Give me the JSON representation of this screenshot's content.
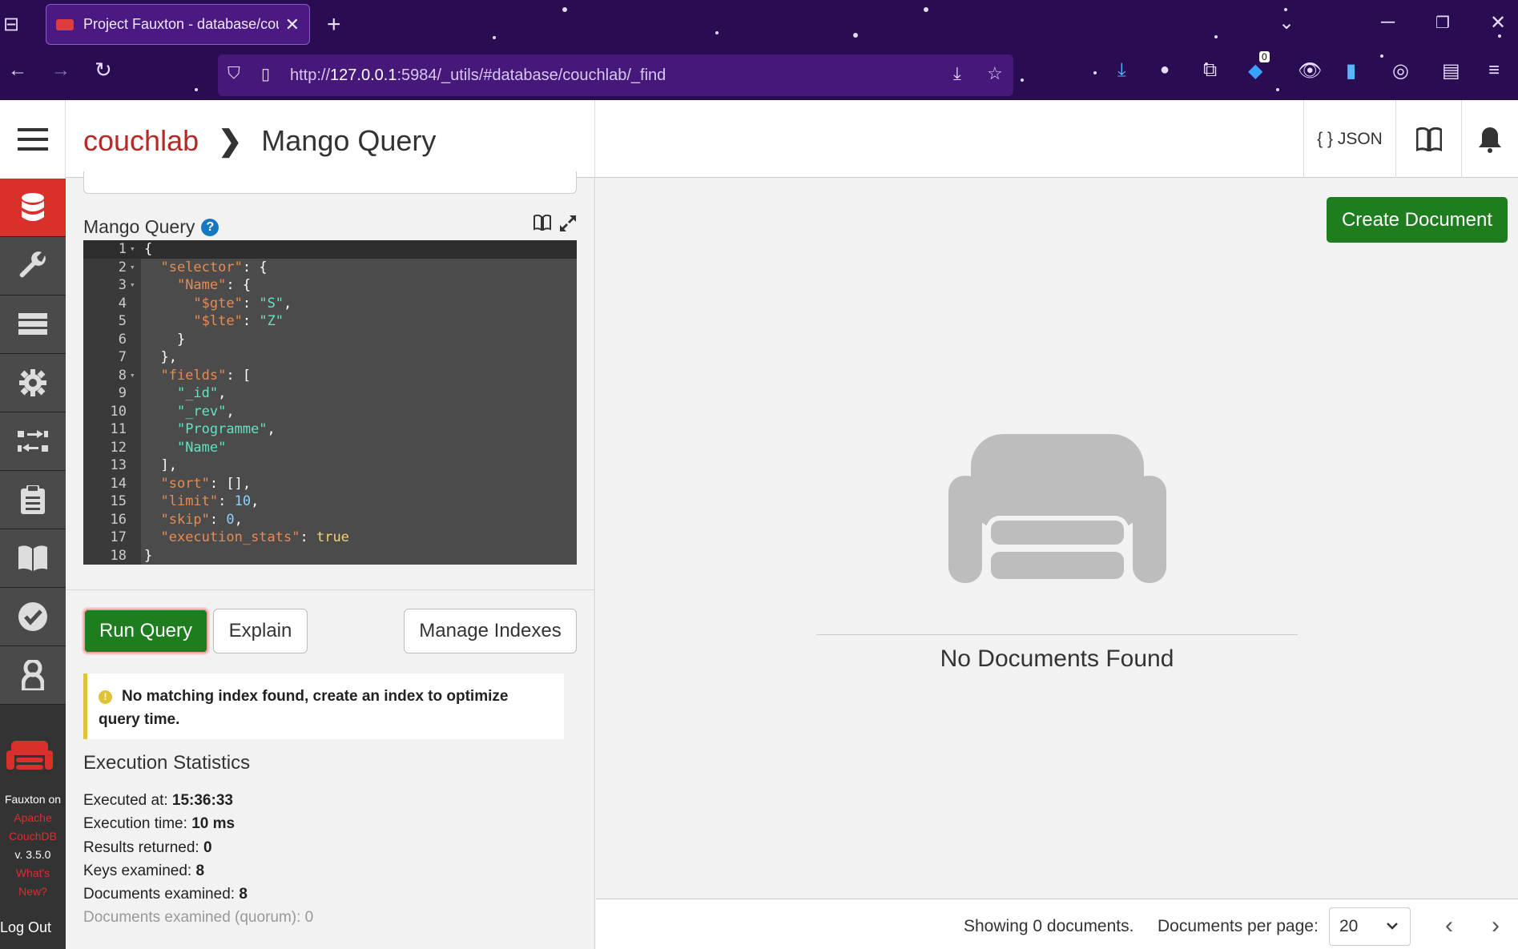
{
  "browser": {
    "tab_title": "Project Fauxton - database/couc",
    "url_prefix": "http://",
    "url_host": "127.0.0.1",
    "url_rest": ":5984/_utils/#database/couchlab/_find",
    "extension_badge": "0"
  },
  "sidebar": {
    "product": "Fauxton on",
    "apache": "Apache",
    "couchdb": "CouchDB",
    "version": "v. 3.5.0",
    "whats_new": "What's New?",
    "logout": "Log Out"
  },
  "header": {
    "database": "couchlab",
    "page": "Mango Query",
    "json_label": "{ } JSON"
  },
  "query": {
    "label": "Mango Query",
    "help": "?",
    "lines": [
      "{",
      "  \"selector\": {",
      "    \"Name\": {",
      "      \"$gte\": \"S\",",
      "      \"$lte\": \"Z\"",
      "    }",
      "  },",
      "  \"fields\": [",
      "    \"_id\",",
      "    \"_rev\",",
      "    \"Programme\",",
      "    \"Name\"",
      "  ],",
      "  \"sort\": [],",
      "  \"limit\": 10,",
      "  \"skip\": 0,",
      "  \"execution_stats\": true",
      "}"
    ],
    "run_button": "Run Query",
    "explain_button": "Explain",
    "indexes_button": "Manage Indexes",
    "warning": "No matching index found, create an index to optimize query time."
  },
  "stats": {
    "title": "Execution Statistics",
    "executed_at_label": "Executed at:",
    "executed_at": "15:36:33",
    "exec_time_label": "Execution time:",
    "exec_time": "10 ms",
    "results_label": "Results returned:",
    "results": "0",
    "keys_label": "Keys examined:",
    "keys": "8",
    "docs_label": "Documents examined:",
    "docs": "8",
    "quorum_label": "Documents examined (quorum):",
    "quorum": "0"
  },
  "results": {
    "create_button": "Create Document",
    "empty_message": "No Documents Found",
    "showing": "Showing 0 documents.",
    "per_page_label": "Documents per page:",
    "per_page_value": "20",
    "prev": "‹",
    "next": "›"
  }
}
